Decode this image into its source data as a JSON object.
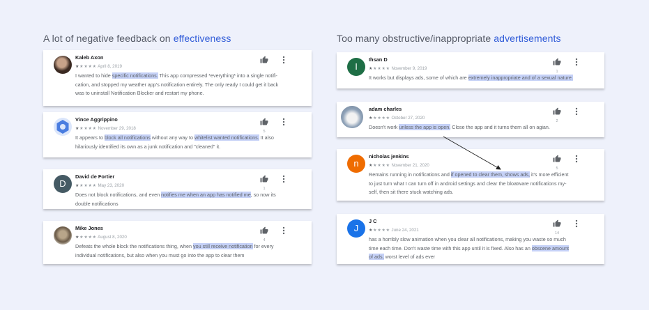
{
  "left_title": {
    "prefix": "A lot of negative feedback on ",
    "keyword": "effectiveness"
  },
  "right_title": {
    "prefix": "Too many obstructive/inappropriate ",
    "keyword": "advertisements"
  },
  "reviews": [
    {
      "name": "Kaleb Axon",
      "date": "April 8, 2019",
      "rating": 1,
      "count": "",
      "lines": [
        [
          {
            "t": "I wanted to hide "
          },
          {
            "t": "specific notifications.",
            "h": true
          },
          {
            "t": " This app compressed *everything* into a single notifi-"
          }
        ],
        [
          {
            "t": "cation, and stopped my weather app's notification entirely. The only ready I could get it back"
          }
        ],
        [
          {
            "t": "was to uninstall Notification Blocker and restart my phone."
          }
        ]
      ]
    },
    {
      "name": "Vince Aggrippino",
      "date": "November 29, 2018",
      "rating": 1,
      "count": "5",
      "lines": [
        [
          {
            "t": "It appears to "
          },
          {
            "t": "block all notifications",
            "h": true
          },
          {
            "t": " without any way to "
          },
          {
            "t": "whitelist wanted notifications.",
            "h": true
          },
          {
            "t": " It also"
          }
        ],
        [
          {
            "t": "hilariously identified its own as a junk notification and \"cleaned\" it."
          }
        ]
      ]
    },
    {
      "name": "David de Fortier",
      "initial": "D",
      "avatar_color": "#455a64",
      "date": "May 23, 2020",
      "rating": 1,
      "count": "1",
      "lines": [
        [
          {
            "t": "Does not block notifications, and even "
          },
          {
            "t": "notifies me when an app has notified me",
            "h": true
          },
          {
            "t": ", so now its"
          }
        ],
        [
          {
            "t": "double notifications"
          }
        ]
      ]
    },
    {
      "name": "Mike Jones",
      "date": "August 8, 2020",
      "rating": 1,
      "count": "4",
      "lines": [
        [
          {
            "t": "Defeats the whole block the notifications thing, when "
          },
          {
            "t": "you still receive notification",
            "h": true
          },
          {
            "t": " for every"
          }
        ],
        [
          {
            "t": "individual notifications, but also when you must go into the app to clear them"
          }
        ]
      ]
    },
    {
      "name": "Ihsan D",
      "initial": "I",
      "avatar_color": "#1e6e45",
      "date": "November 9, 2019",
      "rating": 1,
      "count": "1",
      "lines": [
        [
          {
            "t": "It works but displays ads, some of which are "
          },
          {
            "t": "extremely inappropriate and of a sexual nature.",
            "h": true
          }
        ]
      ]
    },
    {
      "name": "adam charles",
      "date": "October 27, 2020",
      "rating": 1,
      "count": "2",
      "lines": [
        [
          {
            "t": "Doesn't work "
          },
          {
            "t": "unless the app is open.",
            "h": true
          },
          {
            "t": " Close the app and it turns them all on agian."
          }
        ]
      ]
    },
    {
      "name": "nicholas jenkins",
      "initial": "n",
      "avatar_color": "#ef6c00",
      "date": "November 21, 2020",
      "rating": 1,
      "count": "5",
      "lines": [
        [
          {
            "t": "Remains running in notifications and "
          },
          {
            "t": "if opened to clear them, shows ads,",
            "h": true
          },
          {
            "t": " it's more efficient"
          }
        ],
        [
          {
            "t": "to just turn what I can turn off in android settings and clear the bloatware notifications my-"
          }
        ],
        [
          {
            "t": "self, then sit there stuck watching ads."
          }
        ]
      ]
    },
    {
      "name": "J C",
      "initial": "J",
      "avatar_color": "#1a73e8",
      "date": "June 24, 2021",
      "rating": 1,
      "count": "14",
      "lines": [
        [
          {
            "t": "has a horribly slow animation when you clear all notifications, making you waste so much"
          }
        ],
        [
          {
            "t": "time each time. Don't waste time with this app until it is fixed. Also has an "
          },
          {
            "t": "obscene amount",
            "h": true
          }
        ],
        [
          {
            "t": "of ads,",
            "h": true
          },
          {
            "t": " worst level of ads ever"
          }
        ]
      ]
    }
  ]
}
